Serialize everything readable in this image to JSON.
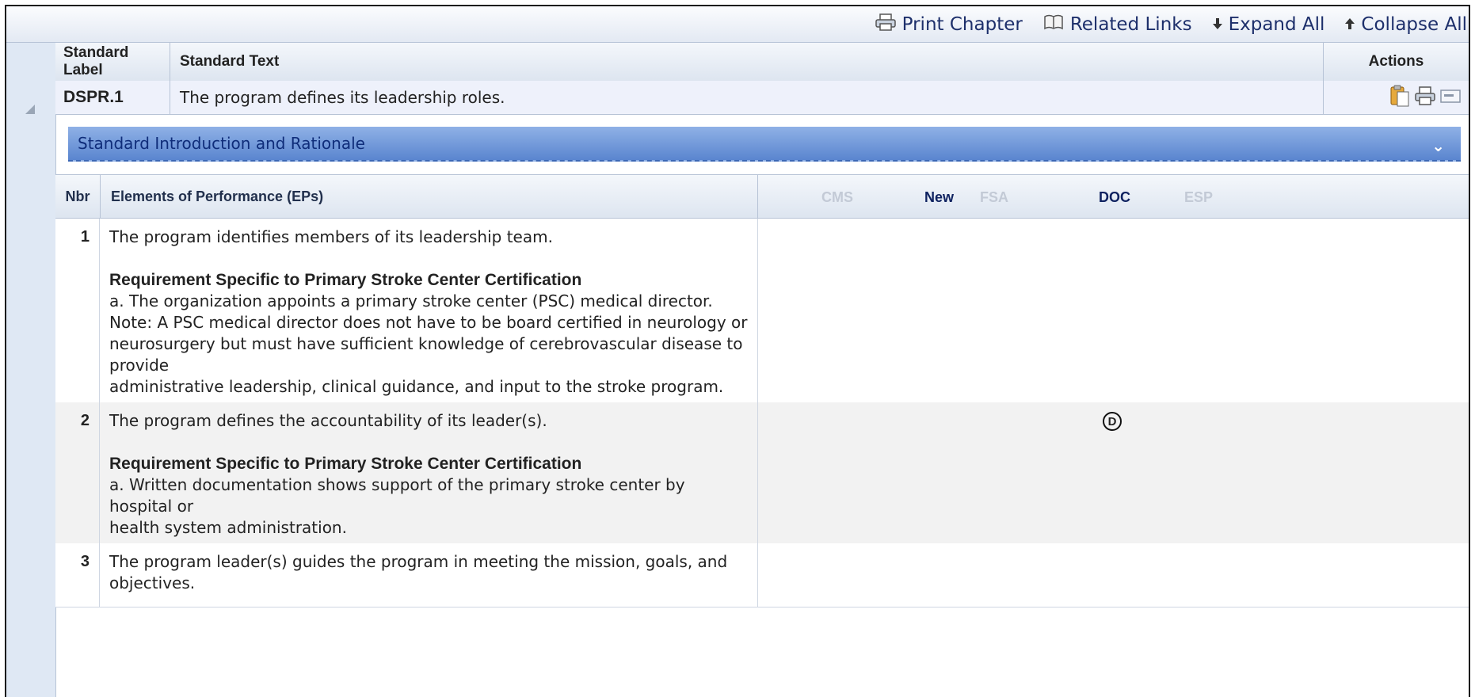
{
  "toolbar": {
    "print_chapter": "Print Chapter",
    "related_links": "Related Links",
    "expand_all": "Expand All",
    "collapse_all": "Collapse All"
  },
  "header": {
    "standard_label": "Standard Label",
    "standard_text": "Standard Text",
    "actions": "Actions"
  },
  "standard": {
    "label": "DSPR.1",
    "text": "The program defines its leadership roles."
  },
  "intro_bar": {
    "label": "Standard Introduction and Rationale"
  },
  "ep_header": {
    "nbr": "Nbr",
    "eps": "Elements of Performance (EPs)",
    "flags": [
      {
        "label": "CMS",
        "active": false
      },
      {
        "label": "New",
        "active": true
      },
      {
        "label": "FSA",
        "active": false
      },
      {
        "label": "DOC",
        "active": true
      },
      {
        "label": "ESP",
        "active": false
      }
    ]
  },
  "eps": [
    {
      "nbr": "1",
      "text": "The program identifies members of its leadership team.",
      "req_title": "Requirement Specific to Primary Stroke Center Certification",
      "req_lines": [
        "a. The organization appoints a primary stroke center (PSC) medical director.",
        "Note: A PSC medical director does not have to be board certified in neurology or",
        "neurosurgery but must have sufficient knowledge of cerebrovascular disease to provide",
        "administrative leadership, clinical guidance, and input to the stroke program."
      ],
      "doc": ""
    },
    {
      "nbr": "2",
      "text": "The program defines the accountability of its leader(s).",
      "req_title": "Requirement Specific to Primary Stroke Center Certification",
      "req_lines": [
        "a. Written documentation shows support of the primary stroke center by hospital or",
        "health system administration."
      ],
      "doc": "D"
    },
    {
      "nbr": "3",
      "text": "The program leader(s) guides the program in meeting the mission, goals, and objectives.",
      "req_title": "",
      "req_lines": [],
      "doc": ""
    }
  ],
  "colors": {
    "accent": "#0f2260",
    "intro_bar": "#6f97da",
    "gutter": "#dfe8f4",
    "row_alt": "#f2f2f2"
  }
}
